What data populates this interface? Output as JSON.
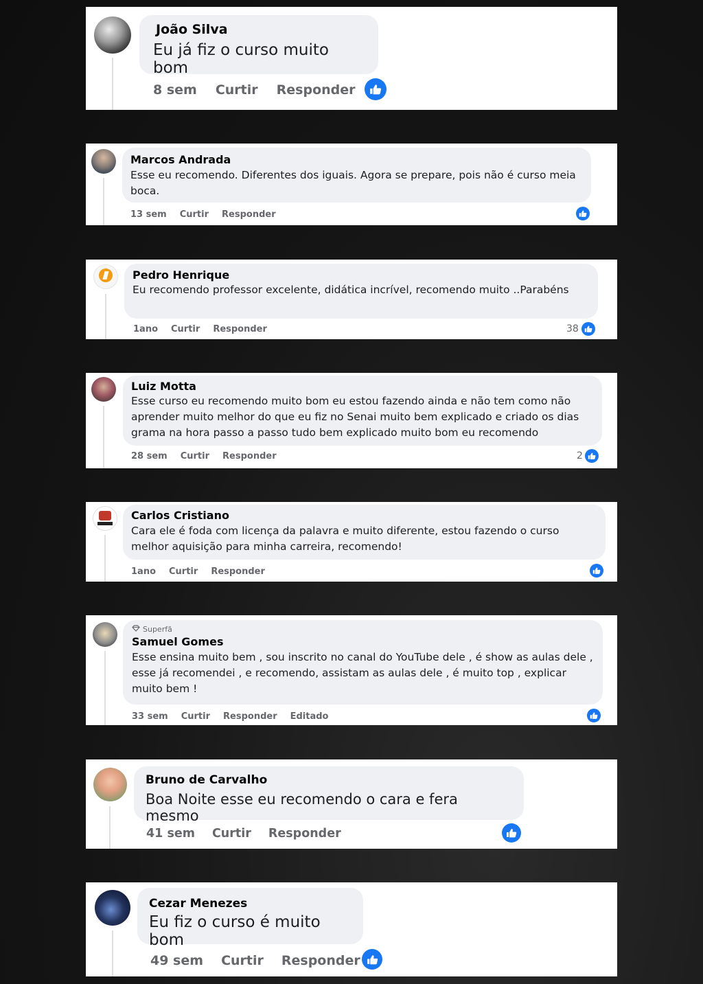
{
  "like_color": "#1877f2",
  "comments": [
    {
      "name": "João Silva",
      "text": "Eu já fiz o curso muito bom",
      "time": "8 sem",
      "like": "Curtir",
      "reply": "Responder"
    },
    {
      "name": "Marcos Andrada",
      "text": "Esse eu recomendo. Diferentes dos iguais. Agora se prepare, pois não é curso meia boca.",
      "time": "13 sem",
      "like": "Curtir",
      "reply": "Responder"
    },
    {
      "name": "Pedro Henrique",
      "text": "Eu recomendo professor excelente, didática incrível, recomendo muito ..Parabéns",
      "time": "1ano",
      "like": "Curtir",
      "reply": "Responder",
      "reactions": "38"
    },
    {
      "name": "Luiz Motta",
      "text": "Esse curso eu recomendo muito bom eu estou fazendo ainda e não tem como não aprender muito melhor do que eu fiz no Senai muito bem explicado e criado os dias grama na hora passo a passo tudo bem explicado muito bom eu recomendo",
      "time": "28 sem",
      "like": "Curtir",
      "reply": "Responder",
      "reactions": "2"
    },
    {
      "name": "Carlos Cristiano",
      "text": "Cara ele é foda com licença da palavra e muito diferente, estou fazendo o curso melhor aquisição para minha carreira, recomendo!",
      "time": "1ano",
      "like": "Curtir",
      "reply": "Responder"
    },
    {
      "name": "Samuel Gomes",
      "badge": "Superfã",
      "text": "Esse ensina muito bem , sou inscrito no canal do YouTube dele , é show as aulas dele , esse já recomendei , e recomendo, assistam as aulas dele , é muito top , explicar muito bem !",
      "time": "33 sem",
      "like": "Curtir",
      "reply": "Responder",
      "edited": "Editado"
    },
    {
      "name": "Bruno de Carvalho",
      "text": "Boa Noite esse eu recomendo o cara e fera mesmo",
      "time": "41 sem",
      "like": "Curtir",
      "reply": "Responder"
    },
    {
      "name": "Cezar Menezes",
      "text": "Eu fiz o curso é muito bom",
      "time": "49 sem",
      "like": "Curtir",
      "reply": "Responder"
    }
  ]
}
